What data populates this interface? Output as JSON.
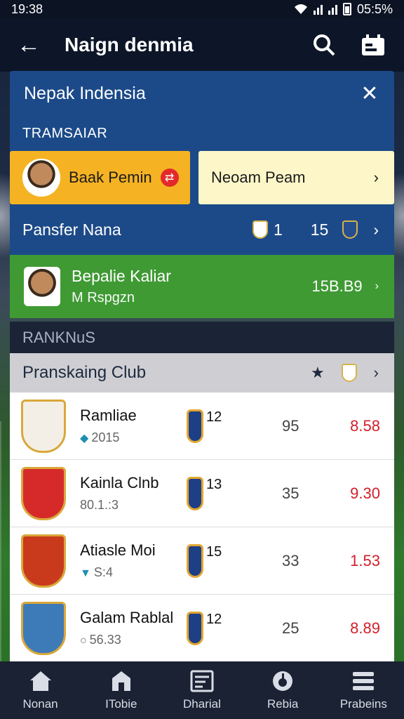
{
  "status_bar": {
    "time": "19:38",
    "battery": "05:5%"
  },
  "app_bar": {
    "title": "Naign denmia"
  },
  "panel": {
    "header": "Nepak Indensia",
    "section": "TRAMSAIAR",
    "choice_a": "Baak Pemin",
    "choice_b": "Neoam Peam",
    "transfer": {
      "label": "Pansfer Nana",
      "num_a": "1",
      "num_b": "15"
    },
    "featured": {
      "name": "Bepalie Kaliar",
      "sub": "M Rspgzn",
      "value": "15B.B9"
    }
  },
  "rankings": {
    "label": "RANKNuS",
    "header": "Pranskaing Club",
    "clubs": [
      {
        "name": "Ramliae",
        "sub": "2015",
        "num": "12",
        "pts": "95",
        "score": "8.58",
        "crest_color": "#f4efe6"
      },
      {
        "name": "Kainla Clnb",
        "sub": "80.1.:3",
        "num": "13",
        "pts": "35",
        "score": "9.30",
        "crest_color": "#d62a2a"
      },
      {
        "name": "Atiasle Moi",
        "sub": "S:4",
        "num": "15",
        "pts": "33",
        "score": "1.53",
        "crest_color": "#c93a1c"
      },
      {
        "name": "Galam Rablal",
        "sub": "56.33",
        "num": "12",
        "pts": "25",
        "score": "8.89",
        "crest_color": "#3d7ab8"
      }
    ]
  },
  "bottom_nav": [
    {
      "label": "Nonan",
      "icon": "home-icon"
    },
    {
      "label": "ITobie",
      "icon": "store-icon"
    },
    {
      "label": "Dharial",
      "icon": "chart-icon"
    },
    {
      "label": "Rebia",
      "icon": "radio-icon"
    },
    {
      "label": "Prabeins",
      "icon": "menu-icon"
    }
  ],
  "colors": {
    "panel_blue": "#1c4a88",
    "accent_orange": "#f5b323",
    "green": "#3f9a34",
    "score_red": "#d11f2a"
  }
}
